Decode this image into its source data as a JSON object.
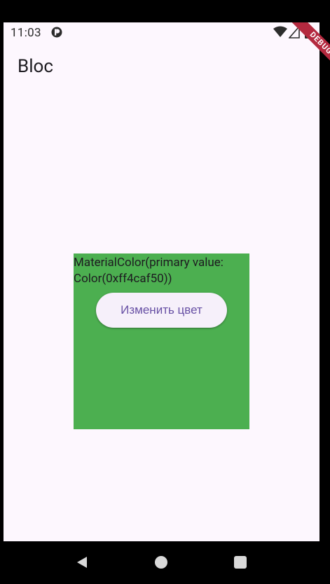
{
  "status_bar": {
    "time": "11:03",
    "app_icon": "app-notification-icon",
    "right_icons": [
      "wifi-icon",
      "signal-icon",
      "battery-icon"
    ]
  },
  "debug_banner": {
    "label": "DEBUG"
  },
  "app_bar": {
    "title": "Bloc"
  },
  "main": {
    "color_value_text": "MaterialColor(primary value: Color(0xff4caf50))",
    "box_color": "#4caf50",
    "change_color_button": "Изменить цвет"
  },
  "nav_bar": {
    "icons": [
      "back-icon",
      "home-icon",
      "recents-icon"
    ]
  },
  "colors": {
    "background": "#fdf7fe",
    "accent": "#6750a4",
    "debug_ribbon": "#b4293f"
  }
}
